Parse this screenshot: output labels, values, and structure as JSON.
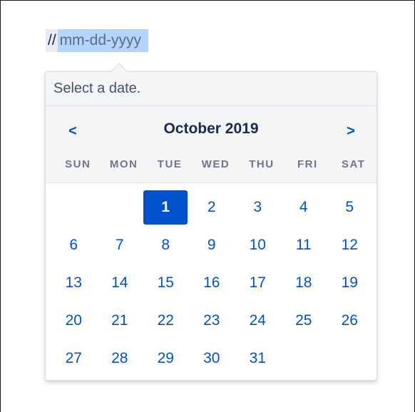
{
  "input": {
    "prefix": "//",
    "placeholder": "mm-dd-yyyy"
  },
  "picker": {
    "hint": "Select a date.",
    "month_label": "October 2019",
    "prev_label": "<",
    "next_label": ">",
    "weekdays": [
      "SUN",
      "MON",
      "TUE",
      "WED",
      "THU",
      "FRI",
      "SAT"
    ],
    "weeks": [
      [
        "",
        "",
        "1",
        "2",
        "3",
        "4",
        "5"
      ],
      [
        "6",
        "7",
        "8",
        "9",
        "10",
        "11",
        "12"
      ],
      [
        "13",
        "14",
        "15",
        "16",
        "17",
        "18",
        "19"
      ],
      [
        "20",
        "21",
        "22",
        "23",
        "24",
        "25",
        "26"
      ],
      [
        "27",
        "28",
        "29",
        "30",
        "31",
        "",
        ""
      ]
    ],
    "selected_day": "1"
  },
  "colors": {
    "accent": "#0052cc",
    "selection_highlight": "#b3d4fc",
    "header_background": "#f4f5f7",
    "title_text": "#172b4d",
    "weekday_text": "#6b778c"
  }
}
